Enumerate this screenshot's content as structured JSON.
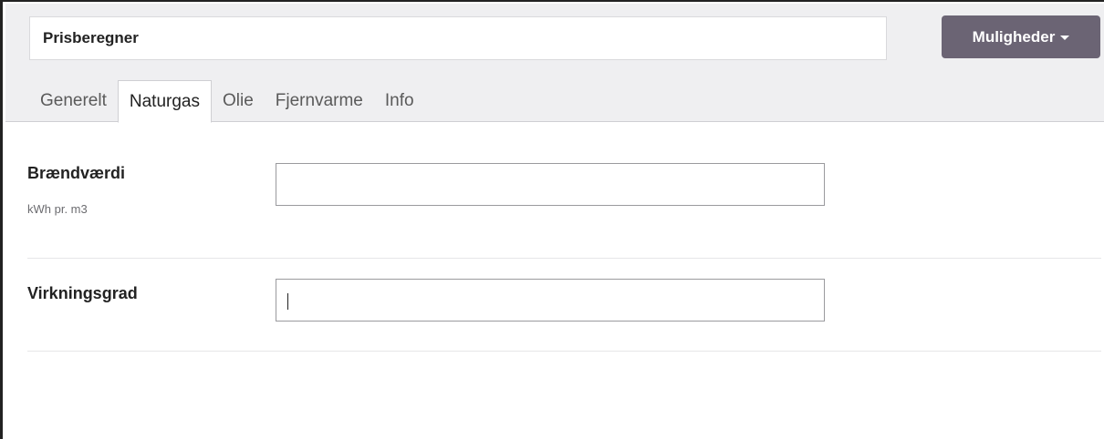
{
  "header": {
    "title": "Prisberegner",
    "options_label": "Muligheder"
  },
  "tabs": [
    {
      "label": "Generelt",
      "active": false
    },
    {
      "label": "Naturgas",
      "active": true
    },
    {
      "label": "Olie",
      "active": false
    },
    {
      "label": "Fjernvarme",
      "active": false
    },
    {
      "label": "Info",
      "active": false
    }
  ],
  "fields": [
    {
      "label": "Brændværdi",
      "help": "kWh pr. m3",
      "value": ""
    },
    {
      "label": "Virkningsgrad",
      "help": "",
      "value": ""
    }
  ]
}
